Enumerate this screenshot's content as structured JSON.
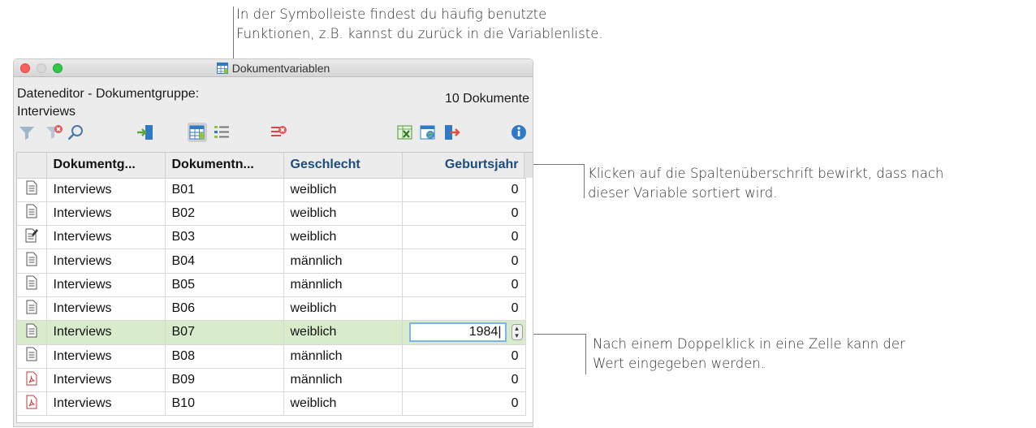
{
  "annotations": {
    "toolbar_note": {
      "line1": "In der Symbolleiste findest du häufig benutzte",
      "line2": "Funktionen, z.B. kannst du zurück in die Variablenliste."
    },
    "header_note": {
      "line1": "Klicken auf die Spaltenüberschrift bewirkt, dass nach",
      "line2": "dieser Variable sortiert wird."
    },
    "cell_note": {
      "line1": "Nach einem Doppelklick in eine Zelle kann der",
      "line2": "Wert eingegeben werden."
    }
  },
  "window": {
    "title": "Dokumentvariablen",
    "title_icon": "table-icon",
    "info_line1": "Dateneditor - Dokumentgruppe:",
    "info_line2": "Interviews",
    "document_count": "10 Dokumente"
  },
  "toolbar": {
    "icons": [
      "filter-icon",
      "clear-filter-icon",
      "search-icon",
      "import-icon",
      "table-view-icon",
      "list-view-icon",
      "delete-icon",
      "excel-export-icon",
      "web-export-icon",
      "export-icon",
      "info-icon"
    ]
  },
  "table": {
    "headers": [
      "Dokumentg...",
      "Dokumentn...",
      "Geschlecht",
      "Geburtsjahr"
    ],
    "rows": [
      {
        "icon": "document-icon",
        "group": "Interviews",
        "name": "B01",
        "gender": "weiblich",
        "year": "0"
      },
      {
        "icon": "document-icon",
        "group": "Interviews",
        "name": "B02",
        "gender": "weiblich",
        "year": "0"
      },
      {
        "icon": "document-edit-icon",
        "group": "Interviews",
        "name": "B03",
        "gender": "weiblich",
        "year": "0"
      },
      {
        "icon": "document-icon",
        "group": "Interviews",
        "name": "B04",
        "gender": "männlich",
        "year": "0"
      },
      {
        "icon": "document-icon",
        "group": "Interviews",
        "name": "B05",
        "gender": "männlich",
        "year": "0"
      },
      {
        "icon": "document-icon",
        "group": "Interviews",
        "name": "B06",
        "gender": "weiblich",
        "year": "0"
      },
      {
        "icon": "document-icon",
        "group": "Interviews",
        "name": "B07",
        "gender": "weiblich",
        "year": "1984"
      },
      {
        "icon": "document-icon",
        "group": "Interviews",
        "name": "B08",
        "gender": "männlich",
        "year": "0"
      },
      {
        "icon": "pdf-icon",
        "group": "Interviews",
        "name": "B09",
        "gender": "männlich",
        "year": "0"
      },
      {
        "icon": "pdf-icon",
        "group": "Interviews",
        "name": "B10",
        "gender": "weiblich",
        "year": "0"
      }
    ]
  },
  "colors": {
    "selected_row": "#d8eccc",
    "variable_header": "#1c4b7c",
    "edit_border": "#7fb4e8"
  }
}
